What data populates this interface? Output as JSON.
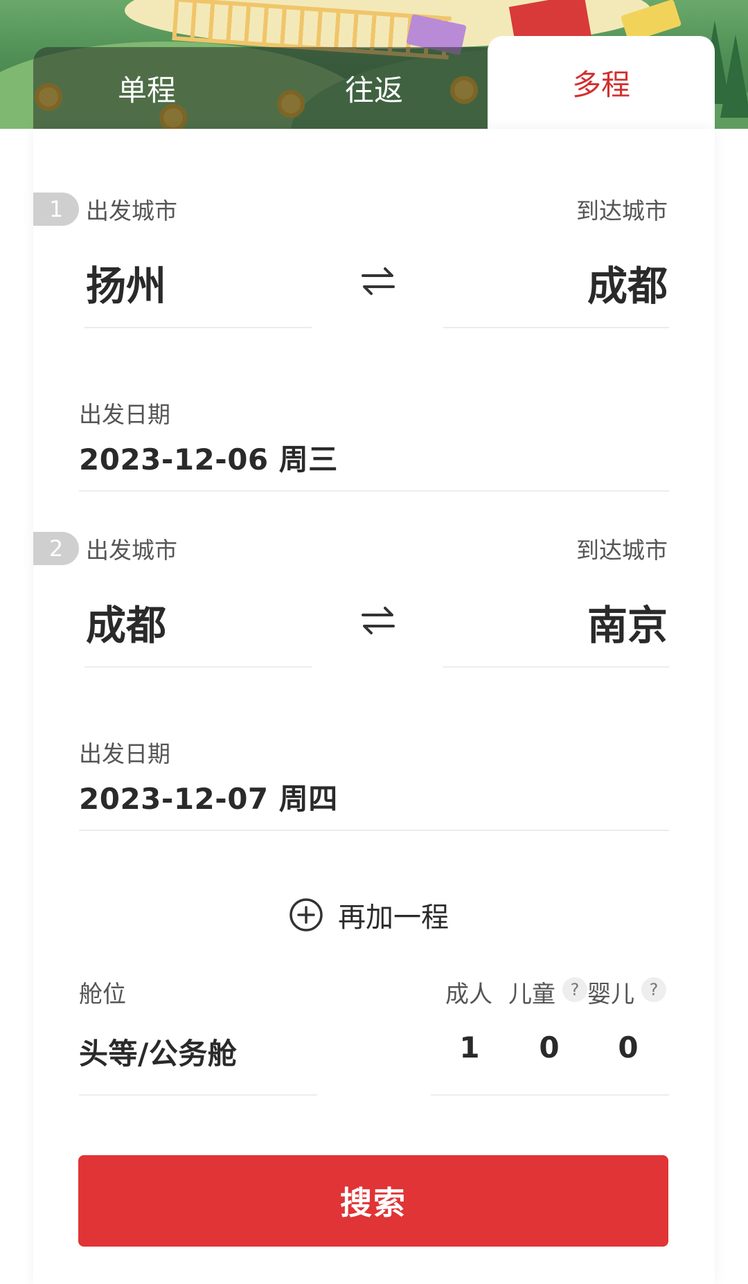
{
  "tabs": [
    {
      "label": "单程",
      "active": false
    },
    {
      "label": "往返",
      "active": false
    },
    {
      "label": "多程",
      "active": true
    }
  ],
  "colors": {
    "accent": "#d32f2f",
    "search_button": "#e03436"
  },
  "legs": [
    {
      "number": "1",
      "depart_label": "出发城市",
      "arrive_label": "到达城市",
      "depart_city": "扬州",
      "arrive_city": "成都",
      "date_label": "出发日期",
      "date": "2023-12-06 周三"
    },
    {
      "number": "2",
      "depart_label": "出发城市",
      "arrive_label": "到达城市",
      "depart_city": "成都",
      "arrive_city": "南京",
      "date_label": "出发日期",
      "date": "2023-12-07 周四"
    }
  ],
  "add_leg_label": "再加一程",
  "cabin": {
    "label": "舱位",
    "value": "头等/公务舱"
  },
  "passengers": {
    "adult_label": "成人",
    "child_label": "儿童",
    "infant_label": "婴儿",
    "help_glyph": "?",
    "adult_count": "1",
    "child_count": "0",
    "infant_count": "0"
  },
  "search_label": "搜索",
  "icons": {
    "swap": "swap-arrows-icon",
    "add": "plus-circle-icon",
    "help": "question-icon"
  }
}
